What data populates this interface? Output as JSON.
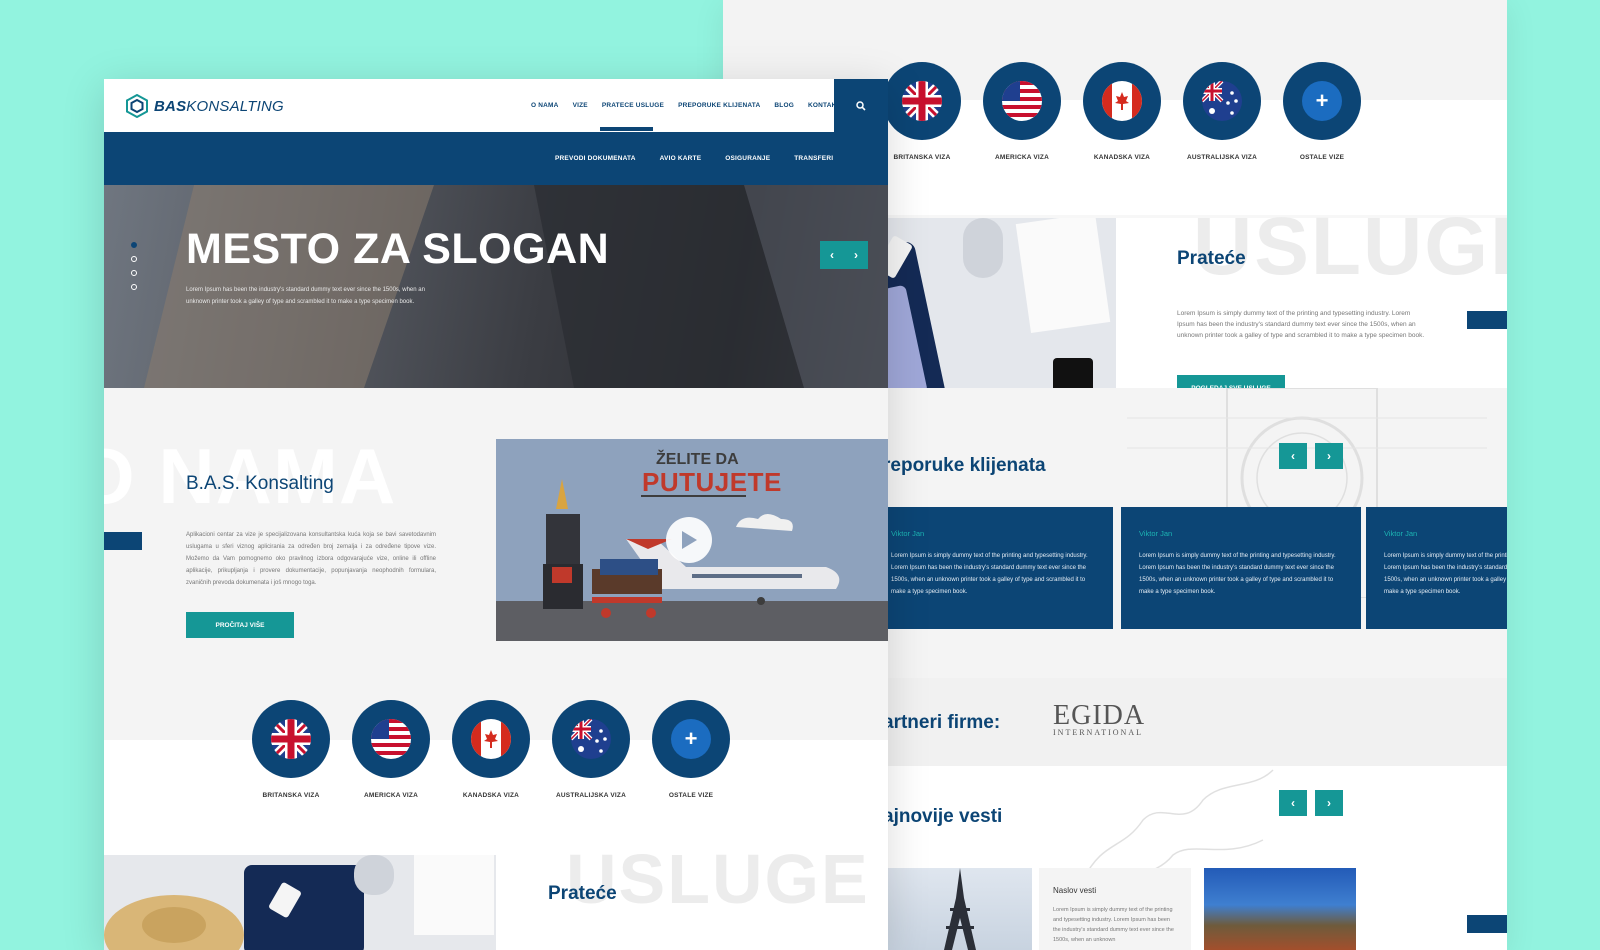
{
  "back": {
    "flags": [
      {
        "label": "BRITANSKA VIZA",
        "flag": "uk"
      },
      {
        "label": "AMERICKA VIZA",
        "flag": "us"
      },
      {
        "label": "KANADSKA VIZA",
        "flag": "ca"
      },
      {
        "label": "AUSTRALIJSKA VIZA",
        "flag": "au"
      },
      {
        "label": "OSTALE VIZE",
        "flag": "plus"
      }
    ],
    "services": {
      "bg_word": "USLUGE",
      "title": "Prateće",
      "description": "Lorem Ipsum is simply dummy text of the printing and typesetting industry. Lorem Ipsum has been the industry's standard dummy text ever since the 1500s, when an unknown printer took a galley of type and scrambled it to make a type specimen book.",
      "button": "POGLEDAJ SVE USLUGE"
    },
    "testimonials": {
      "title": "reporuke klijenata",
      "prev": "‹",
      "next": "›",
      "cards": [
        {
          "name": "Viktor Jan",
          "text": "Lorem Ipsum is simply dummy text of the printing and typesetting industry. Lorem Ipsum has been the industry's standard dummy text ever since the 1500s, when an unknown printer took a galley of type and scrambled it to make a type specimen book."
        },
        {
          "name": "Viktor Jan",
          "text": "Lorem Ipsum is simply dummy text of the printing and typesetting industry. Lorem Ipsum has been the industry's standard dummy text ever since the 1500s, when an unknown printer took a galley of type and scrambled it to make a type specimen book."
        },
        {
          "name": "Viktor Jan",
          "text": "Lorem Ipsum is simply dummy text of the printing and typesetting industry. Lorem Ipsum has been the industry's standard dummy text ever since the 1500s, when an unknown printer took a galley of type and scrambled it to make a type specimen book."
        }
      ]
    },
    "partners": {
      "title": "artneri firme:",
      "logo_main": "EGIDA",
      "logo_sub": "INTERNATIONAL"
    },
    "news": {
      "title": "ajnovije vesti",
      "prev": "‹",
      "next": "›",
      "card_title": "Naslov vesti",
      "card_text": "Lorem Ipsum is simply dummy text of the printing and typesetting industry. Lorem Ipsum has been the industry's standard dummy text ever since the 1500s, when an unknown"
    }
  },
  "front": {
    "logo": {
      "bold": "BAS",
      "light": "KONSALTING"
    },
    "nav": [
      "O NAMA",
      "VIZE",
      "PRATECE USLUGE",
      "PREPORUKE KLIJENATA",
      "BLOG",
      "KONTAKT"
    ],
    "subnav": [
      "PREVODI DOKUMENATA",
      "AVIO KARTE",
      "OSIGURANJE",
      "TRANSFERI"
    ],
    "hero": {
      "title": "MESTO ZA SLOGAN",
      "subtitle": "Lorem Ipsum has been the industry's standard dummy text ever since the 1500s, when an unknown printer took a galley of type and scrambled it to make a type specimen book.",
      "prev": "‹",
      "next": "›"
    },
    "about": {
      "bg_word": "O NAMA",
      "title": "B.A.S. Konsalting",
      "text": "Aplikacioni centar za vize je specijalizovana konsultantska kuća koja se bavi savetodavnim uslugama u sferi viznog aplicirania za određen broj zemalja i za određene tipove vize. Možemo da Vam pomognemo oko pravilnog izbora odgovarajuće vize, online ili offline aplikacije, prikupljanja i provere dokumentacije, popunjavanja neophodnih formulara, zvaničnih prevoda dokumenata i još mnogo toga.",
      "button": "PROČITAJ VIŠE"
    },
    "video": {
      "line1": "ŽELITE DA",
      "line2": "PUTUJETE"
    },
    "flags": [
      {
        "label": "BRITANSKA VIZA",
        "flag": "uk"
      },
      {
        "label": "AMERICKA VIZA",
        "flag": "us"
      },
      {
        "label": "KANADSKA VIZA",
        "flag": "ca"
      },
      {
        "label": "AUSTRALIJSKA VIZA",
        "flag": "au"
      },
      {
        "label": "OSTALE VIZE",
        "flag": "plus"
      }
    ],
    "services": {
      "bg_word": "USLUGE",
      "title": "Prateće"
    }
  },
  "colors": {
    "background": "#92f3df",
    "primary": "#0c4575",
    "accent": "#159796"
  }
}
